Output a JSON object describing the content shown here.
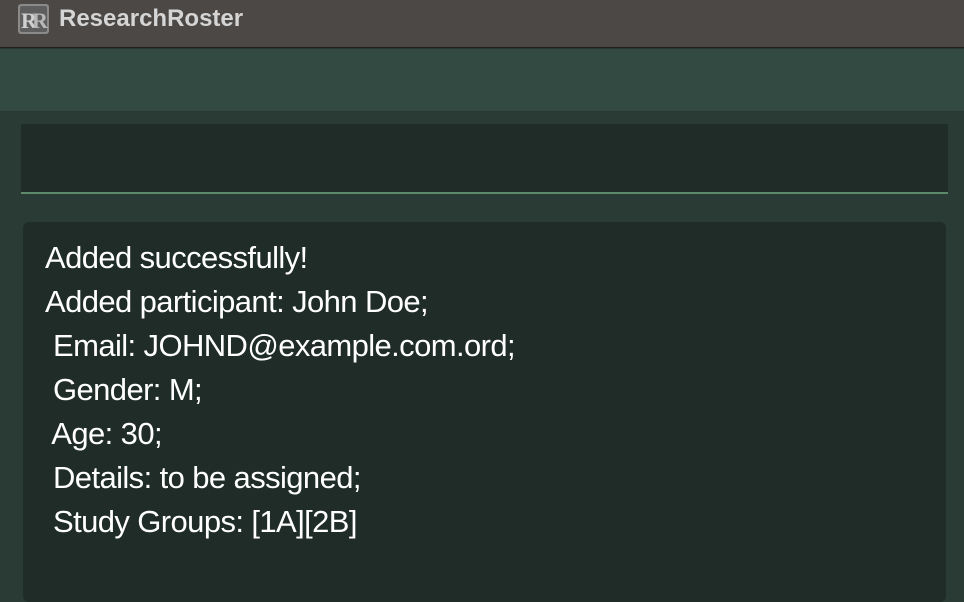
{
  "app": {
    "title": "ResearchRoster",
    "logo_icon": "research-roster-logo-icon"
  },
  "command": {
    "value": ""
  },
  "result": {
    "lines": [
      "Added successfully!",
      "Added participant: John Doe;",
      " Email: JOHND@example.com.ord;",
      " Gender: M;",
      " Age: 30;",
      " Details: to be assigned;",
      " Study Groups: [1A][2B]"
    ]
  },
  "colors": {
    "titlebar": "#4b4846",
    "toolbar": "#324a42",
    "background": "#2a3b35",
    "panel": "#1f2c27",
    "accent": "#5e8a6c",
    "text": "#ffffff"
  }
}
